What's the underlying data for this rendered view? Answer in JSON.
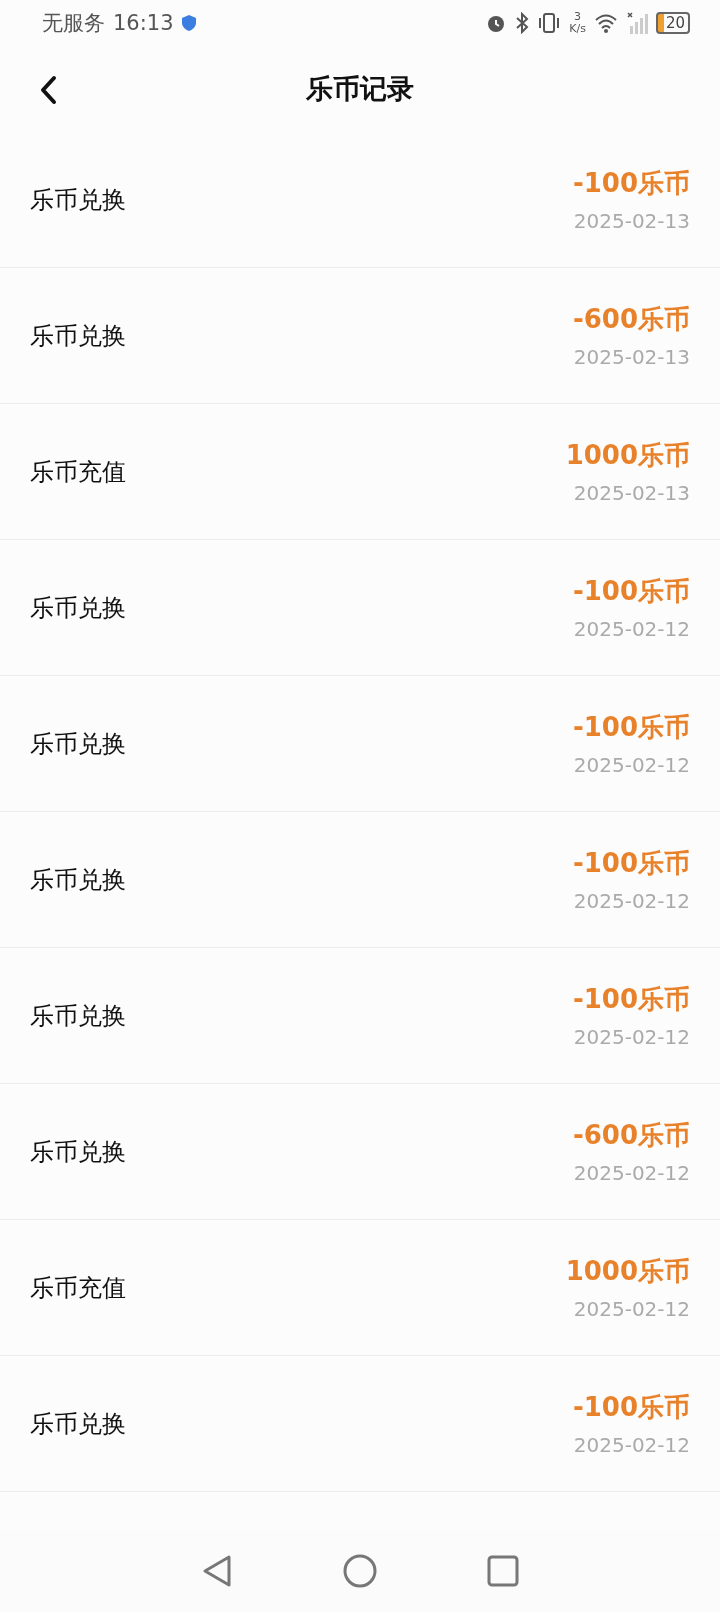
{
  "status_bar": {
    "carrier": "无服务",
    "time": "16:13",
    "speed_value": "3",
    "speed_unit": "K/s",
    "battery": "20"
  },
  "header": {
    "title": "乐币记录"
  },
  "records": [
    {
      "title": "乐币兑换",
      "amount": "-100乐币",
      "date": "2025-02-13"
    },
    {
      "title": "乐币兑换",
      "amount": "-600乐币",
      "date": "2025-02-13"
    },
    {
      "title": "乐币充值",
      "amount": "1000乐币",
      "date": "2025-02-13"
    },
    {
      "title": "乐币兑换",
      "amount": "-100乐币",
      "date": "2025-02-12"
    },
    {
      "title": "乐币兑换",
      "amount": "-100乐币",
      "date": "2025-02-12"
    },
    {
      "title": "乐币兑换",
      "amount": "-100乐币",
      "date": "2025-02-12"
    },
    {
      "title": "乐币兑换",
      "amount": "-100乐币",
      "date": "2025-02-12"
    },
    {
      "title": "乐币兑换",
      "amount": "-600乐币",
      "date": "2025-02-12"
    },
    {
      "title": "乐币充值",
      "amount": "1000乐币",
      "date": "2025-02-12"
    },
    {
      "title": "乐币兑换",
      "amount": "-100乐币",
      "date": "2025-02-12"
    }
  ]
}
